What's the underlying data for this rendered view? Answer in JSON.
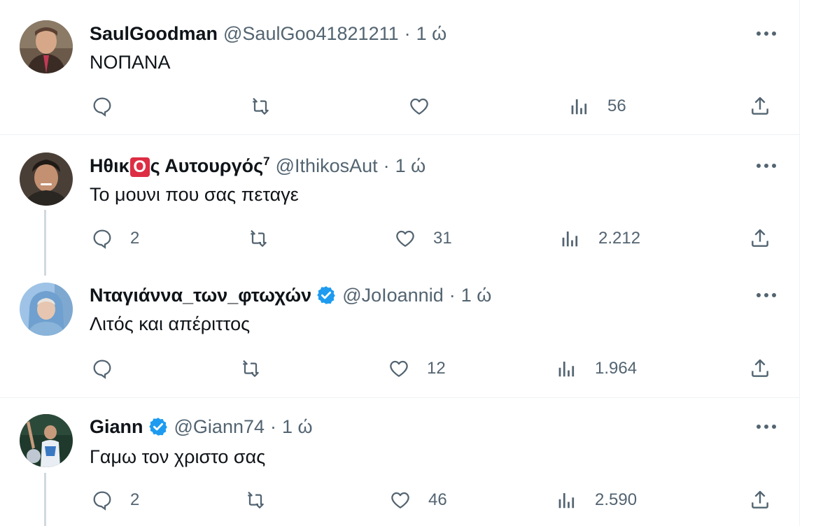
{
  "colors": {
    "text": "#0f1419",
    "secondary": "#536471",
    "border": "#eff3f4",
    "thread": "#cfd9de",
    "verified": "#1d9bf0"
  },
  "tweets": [
    {
      "name": "SaulGoodman",
      "handle": "@SaulGoo41821211",
      "time": "1 ώ",
      "text": "ΝΟΠΑΝΑ",
      "replies": "",
      "retweets": "",
      "likes": "",
      "views": "56"
    },
    {
      "name_pre": "Ηθικ",
      "name_badge": "O",
      "name_post": "ς Αυτουργός",
      "name_sup": "7",
      "handle": "@IthikosAut",
      "time": "1 ώ",
      "text": "Το μουνι που σας πεταγε",
      "replies": "2",
      "retweets": "",
      "likes": "31",
      "views": "2.212"
    },
    {
      "name": "Νταγιάννα_των_φτωχών",
      "verified": true,
      "handle": "@JoIoannid",
      "time": "1 ώ",
      "text": "Λιτός και απέριττος",
      "replies": "",
      "retweets": "",
      "likes": "12",
      "views": "1.964"
    },
    {
      "name": "Giann",
      "verified": true,
      "handle": "@Giann74",
      "time": "1 ώ",
      "text": "Γαμω τον χριστο σας",
      "replies": "2",
      "retweets": "",
      "likes": "46",
      "views": "2.590"
    }
  ],
  "icons": [
    "reply-icon",
    "retweet-icon",
    "like-icon",
    "views-icon",
    "share-icon",
    "more-icon",
    "verified-badge-icon"
  ]
}
